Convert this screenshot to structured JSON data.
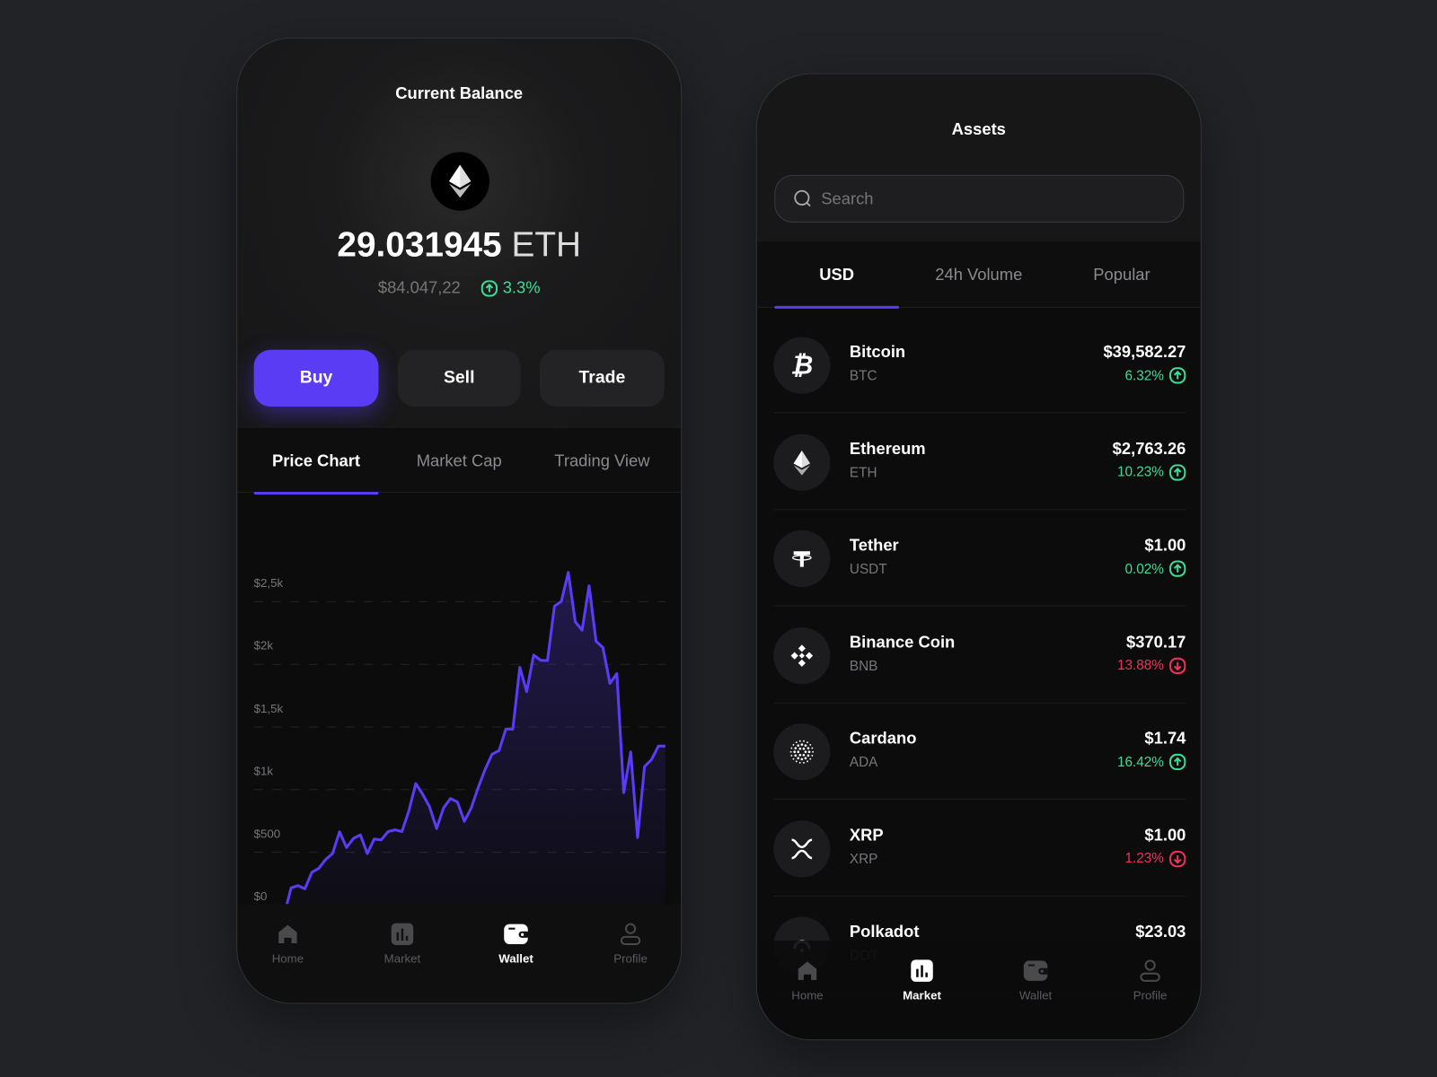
{
  "colors": {
    "accent": "#5b3cf5",
    "up": "#3ddc97",
    "down": "#f0325a",
    "background": "#222327"
  },
  "wallet_screen": {
    "title": "Current Balance",
    "coin_icon": "ethereum-icon",
    "balance_amount": "29.031945",
    "balance_unit": "ETH",
    "fiat_value": "$84.047,22",
    "change": "3.3%",
    "change_direction": "up",
    "buttons": {
      "buy": "Buy",
      "sell": "Sell",
      "trade": "Trade"
    },
    "tabs": [
      {
        "label": "Price Chart",
        "active": true
      },
      {
        "label": "Market Cap",
        "active": false
      },
      {
        "label": "Trading View",
        "active": false
      }
    ],
    "nav": [
      {
        "label": "Home",
        "icon": "home-icon"
      },
      {
        "label": "Market",
        "icon": "bar-chart-icon"
      },
      {
        "label": "Wallet",
        "icon": "wallet-icon",
        "active": true
      },
      {
        "label": "Profile",
        "icon": "user-icon"
      }
    ]
  },
  "chart_data": {
    "type": "area",
    "ylim": [
      0,
      2500
    ],
    "yticks": [
      0,
      500,
      1000,
      1500,
      2000,
      2500
    ],
    "ytick_labels": [
      "$0",
      "$500",
      "$1k",
      "$1,5k",
      "$2k",
      "$2,5k"
    ],
    "grid": true,
    "line_color": "#5b3cf5",
    "values": [
      0,
      215,
      234,
      208,
      340,
      371,
      443,
      490,
      663,
      538,
      610,
      639,
      490,
      605,
      598,
      665,
      679,
      665,
      830,
      1048,
      962,
      861,
      689,
      854,
      928,
      902,
      746,
      854,
      1017,
      1160,
      1282,
      1311,
      1483,
      1483,
      1976,
      1782,
      2074,
      2033,
      2029,
      2464,
      2502,
      2734,
      2340,
      2273,
      2627,
      2184,
      2134,
      1847,
      1926,
      976,
      1301,
      617,
      1184,
      1239,
      1347,
      1347
    ]
  },
  "assets_screen": {
    "title": "Assets",
    "search_placeholder": "Search",
    "tabs": [
      {
        "label": "USD",
        "active": true
      },
      {
        "label": "24h Volume",
        "active": false
      },
      {
        "label": "Popular",
        "active": false
      }
    ],
    "assets": [
      {
        "name": "Bitcoin",
        "symbol": "BTC",
        "price": "$39,582.27",
        "change": "6.32%",
        "direction": "up",
        "icon": "bitcoin-icon"
      },
      {
        "name": "Ethereum",
        "symbol": "ETH",
        "price": "$2,763.26",
        "change": "10.23%",
        "direction": "up",
        "icon": "ethereum-icon"
      },
      {
        "name": "Tether",
        "symbol": "USDT",
        "price": "$1.00",
        "change": "0.02%",
        "direction": "up",
        "icon": "tether-icon"
      },
      {
        "name": "Binance Coin",
        "symbol": "BNB",
        "price": "$370.17",
        "change": "13.88%",
        "direction": "down",
        "icon": "binance-icon"
      },
      {
        "name": "Cardano",
        "symbol": "ADA",
        "price": "$1.74",
        "change": "16.42%",
        "direction": "up",
        "icon": "cardano-icon"
      },
      {
        "name": "XRP",
        "symbol": "XRP",
        "price": "$1.00",
        "change": "1.23%",
        "direction": "down",
        "icon": "xrp-icon"
      },
      {
        "name": "Polkadot",
        "symbol": "DOT",
        "price": "$23.03",
        "change": "",
        "direction": "down",
        "icon": "polkadot-icon"
      }
    ],
    "nav": [
      {
        "label": "Home",
        "icon": "home-icon"
      },
      {
        "label": "Market",
        "icon": "bar-chart-icon",
        "active": true
      },
      {
        "label": "Wallet",
        "icon": "wallet-icon"
      },
      {
        "label": "Profile",
        "icon": "user-icon"
      }
    ]
  }
}
